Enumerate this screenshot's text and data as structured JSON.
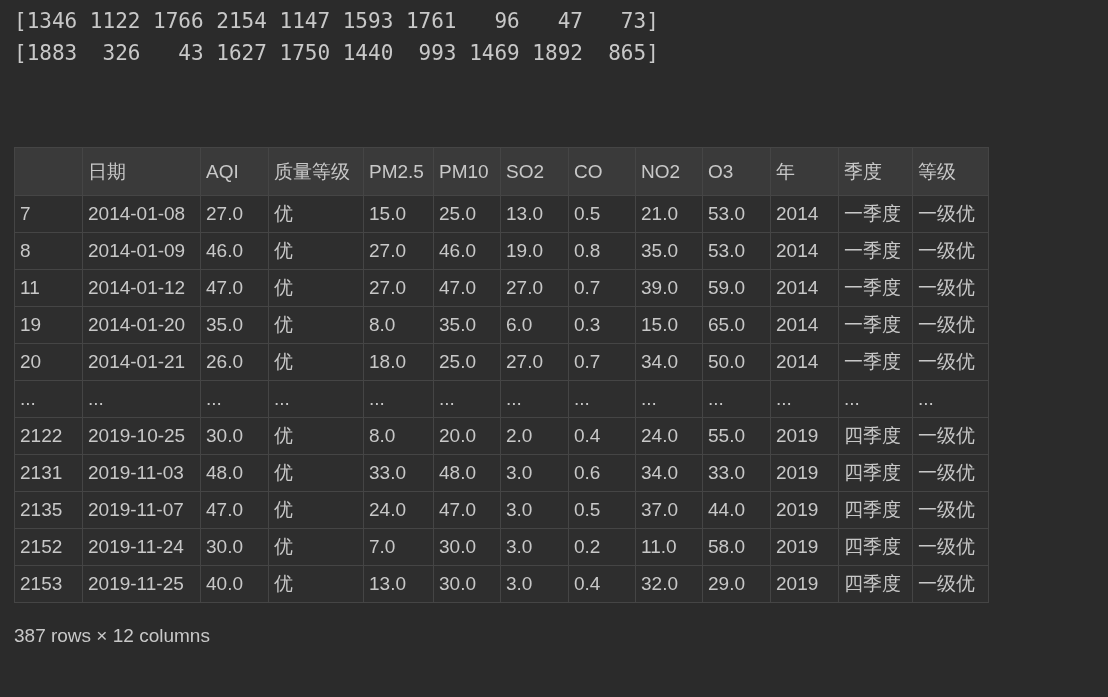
{
  "output_lines": [
    "[1346 1122 1766 2154 1147 1593 1761   96   47   73]",
    "[1883  326   43 1627 1750 1440  993 1469 1892  865]"
  ],
  "table": {
    "columns": [
      "",
      "日期",
      "AQI",
      "质量等级",
      "PM2.5",
      "PM10",
      "SO2",
      "CO",
      "NO2",
      "O3",
      "年",
      "季度",
      "等级"
    ],
    "rows": [
      [
        "7",
        "2014-01-08",
        "27.0",
        "优",
        "15.0",
        "25.0",
        "13.0",
        "0.5",
        "21.0",
        "53.0",
        "2014",
        "一季度",
        "一级优"
      ],
      [
        "8",
        "2014-01-09",
        "46.0",
        "优",
        "27.0",
        "46.0",
        "19.0",
        "0.8",
        "35.0",
        "53.0",
        "2014",
        "一季度",
        "一级优"
      ],
      [
        "11",
        "2014-01-12",
        "47.0",
        "优",
        "27.0",
        "47.0",
        "27.0",
        "0.7",
        "39.0",
        "59.0",
        "2014",
        "一季度",
        "一级优"
      ],
      [
        "19",
        "2014-01-20",
        "35.0",
        "优",
        "8.0",
        "35.0",
        "6.0",
        "0.3",
        "15.0",
        "65.0",
        "2014",
        "一季度",
        "一级优"
      ],
      [
        "20",
        "2014-01-21",
        "26.0",
        "优",
        "18.0",
        "25.0",
        "27.0",
        "0.7",
        "34.0",
        "50.0",
        "2014",
        "一季度",
        "一级优"
      ],
      [
        "...",
        "...",
        "...",
        "...",
        "...",
        "...",
        "...",
        "...",
        "...",
        "...",
        "...",
        "...",
        "..."
      ],
      [
        "2122",
        "2019-10-25",
        "30.0",
        "优",
        "8.0",
        "20.0",
        "2.0",
        "0.4",
        "24.0",
        "55.0",
        "2019",
        "四季度",
        "一级优"
      ],
      [
        "2131",
        "2019-11-03",
        "48.0",
        "优",
        "33.0",
        "48.0",
        "3.0",
        "0.6",
        "34.0",
        "33.0",
        "2019",
        "四季度",
        "一级优"
      ],
      [
        "2135",
        "2019-11-07",
        "47.0",
        "优",
        "24.0",
        "47.0",
        "3.0",
        "0.5",
        "37.0",
        "44.0",
        "2019",
        "四季度",
        "一级优"
      ],
      [
        "2152",
        "2019-11-24",
        "30.0",
        "优",
        "7.0",
        "30.0",
        "3.0",
        "0.2",
        "11.0",
        "58.0",
        "2019",
        "四季度",
        "一级优"
      ],
      [
        "2153",
        "2019-11-25",
        "40.0",
        "优",
        "13.0",
        "30.0",
        "3.0",
        "0.4",
        "32.0",
        "29.0",
        "2019",
        "四季度",
        "一级优"
      ]
    ]
  },
  "summary": "387 rows × 12 columns"
}
